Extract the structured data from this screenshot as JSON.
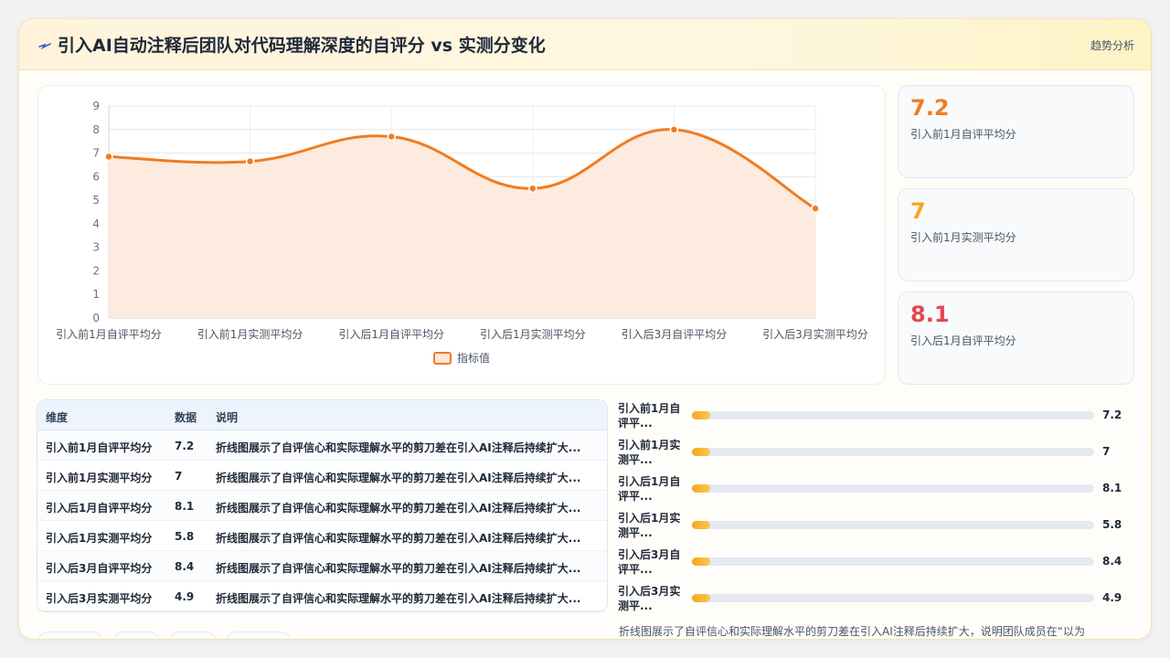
{
  "header": {
    "title": "引入AI自动注释后团队对代码理解深度的自评分 vs 实测分变化",
    "tag": "趋势分析"
  },
  "chart_data": {
    "type": "area",
    "categories": [
      "引入前1月自评平均分",
      "引入前1月实测平均分",
      "引入后1月自评平均分",
      "引入后1月实测平均分",
      "引入后3月自评平均分",
      "引入后3月实测平均分"
    ],
    "series": [
      {
        "name": "指标值",
        "values": [
          6.85,
          6.65,
          7.7,
          5.5,
          8.0,
          4.65
        ]
      }
    ],
    "ylim": [
      0,
      9
    ],
    "yticks": [
      0,
      1,
      2,
      3,
      4,
      5,
      6,
      7,
      8,
      9
    ],
    "grid": true,
    "legend": "bottom",
    "line_color": "#f07c22",
    "fill_color": "#fde7d9"
  },
  "kpis": [
    {
      "value": "7.2",
      "label": "引入前1月自评平均分",
      "color": "#f07c22"
    },
    {
      "value": "7",
      "label": "引入前1月实测平均分",
      "color": "#f5a623"
    },
    {
      "value": "8.1",
      "label": "引入后1月自评平均分",
      "color": "#e5484d"
    }
  ],
  "table": {
    "headers": [
      "维度",
      "数据",
      "说明"
    ],
    "rows": [
      [
        "引入前1月自评平均分",
        "7.2",
        "折线图展示了自评信心和实际理解水平的剪刀差在引入AI注释后持续扩大..."
      ],
      [
        "引入前1月实测平均分",
        "7",
        "折线图展示了自评信心和实际理解水平的剪刀差在引入AI注释后持续扩大..."
      ],
      [
        "引入后1月自评平均分",
        "8.1",
        "折线图展示了自评信心和实际理解水平的剪刀差在引入AI注释后持续扩大..."
      ],
      [
        "引入后1月实测平均分",
        "5.8",
        "折线图展示了自评信心和实际理解水平的剪刀差在引入AI注释后持续扩大..."
      ],
      [
        "引入后3月自评平均分",
        "8.4",
        "折线图展示了自评信心和实际理解水平的剪刀差在引入AI注释后持续扩大..."
      ],
      [
        "引入后3月实测平均分",
        "4.9",
        "折线图展示了自评信心和实际理解水平的剪刀差在引入AI注释后持续扩大..."
      ]
    ]
  },
  "bars": [
    {
      "l1": "引入前1月自",
      "l2": "评平...",
      "value": "7.2",
      "fraction": 0.02
    },
    {
      "l1": "引入前1月实",
      "l2": "测平...",
      "value": "7",
      "fraction": 0.02
    },
    {
      "l1": "引入后1月自",
      "l2": "评平...",
      "value": "8.1",
      "fraction": 0.02
    },
    {
      "l1": "引入后1月实",
      "l2": "测平...",
      "value": "5.8",
      "fraction": 0.02
    },
    {
      "l1": "引入后3月自",
      "l2": "评平...",
      "value": "8.4",
      "fraction": 0.02
    },
    {
      "l1": "引入后3月实",
      "l2": "测平...",
      "value": "4.9",
      "fraction": 0.02
    }
  ],
  "description": "折线图展示了自评信心和实际理解水平的剪刀差在引入AI注释后持续扩大，说明团队成员在“以为"
}
